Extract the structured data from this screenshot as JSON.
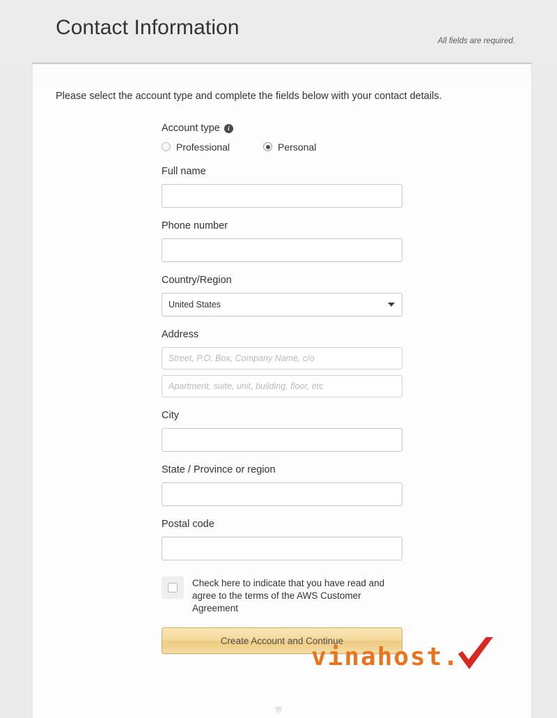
{
  "header": {
    "title": "Contact Information",
    "required_note": "All fields are required."
  },
  "form": {
    "intro": "Please select the account type and complete the fields below with your contact details.",
    "account_type": {
      "label": "Account type",
      "info_icon": "info-icon",
      "info_glyph": "i",
      "options": [
        {
          "label": "Professional",
          "selected": false
        },
        {
          "label": "Personal",
          "selected": true
        }
      ]
    },
    "fields": {
      "full_name": {
        "label": "Full name",
        "value": "",
        "placeholder": ""
      },
      "phone_number": {
        "label": "Phone number",
        "value": "",
        "placeholder": ""
      },
      "country_region": {
        "label": "Country/Region",
        "selected": "United States",
        "caret_icon": "chevron-down-icon"
      },
      "address": {
        "label": "Address",
        "line1_value": "",
        "line1_placeholder": "Street, P.O. Box, Company Name, c/o",
        "line2_value": "",
        "line2_placeholder": "Apartment, suite, unit, building, floor, etc"
      },
      "city": {
        "label": "City",
        "value": "",
        "placeholder": ""
      },
      "state": {
        "label": "State / Province or region",
        "value": "",
        "placeholder": ""
      },
      "postal_code": {
        "label": "Postal code",
        "value": "",
        "placeholder": ""
      }
    },
    "agreement": {
      "checked": false,
      "text": "Check here to indicate that you have read and agree to the terms of the AWS Customer Agreement"
    },
    "submit_label": "Create Account and Continue"
  },
  "watermark": {
    "text": "vinahost.",
    "check_icon": "checkmark-icon",
    "text_color": "#e8741e",
    "check_color": "#d92a21"
  },
  "colors": {
    "page_background": "#ebebeb",
    "panel_background": "#fdfdfd",
    "text": "#333333",
    "button_gold": "#f1d293",
    "input_border": "#c6c6c6"
  }
}
